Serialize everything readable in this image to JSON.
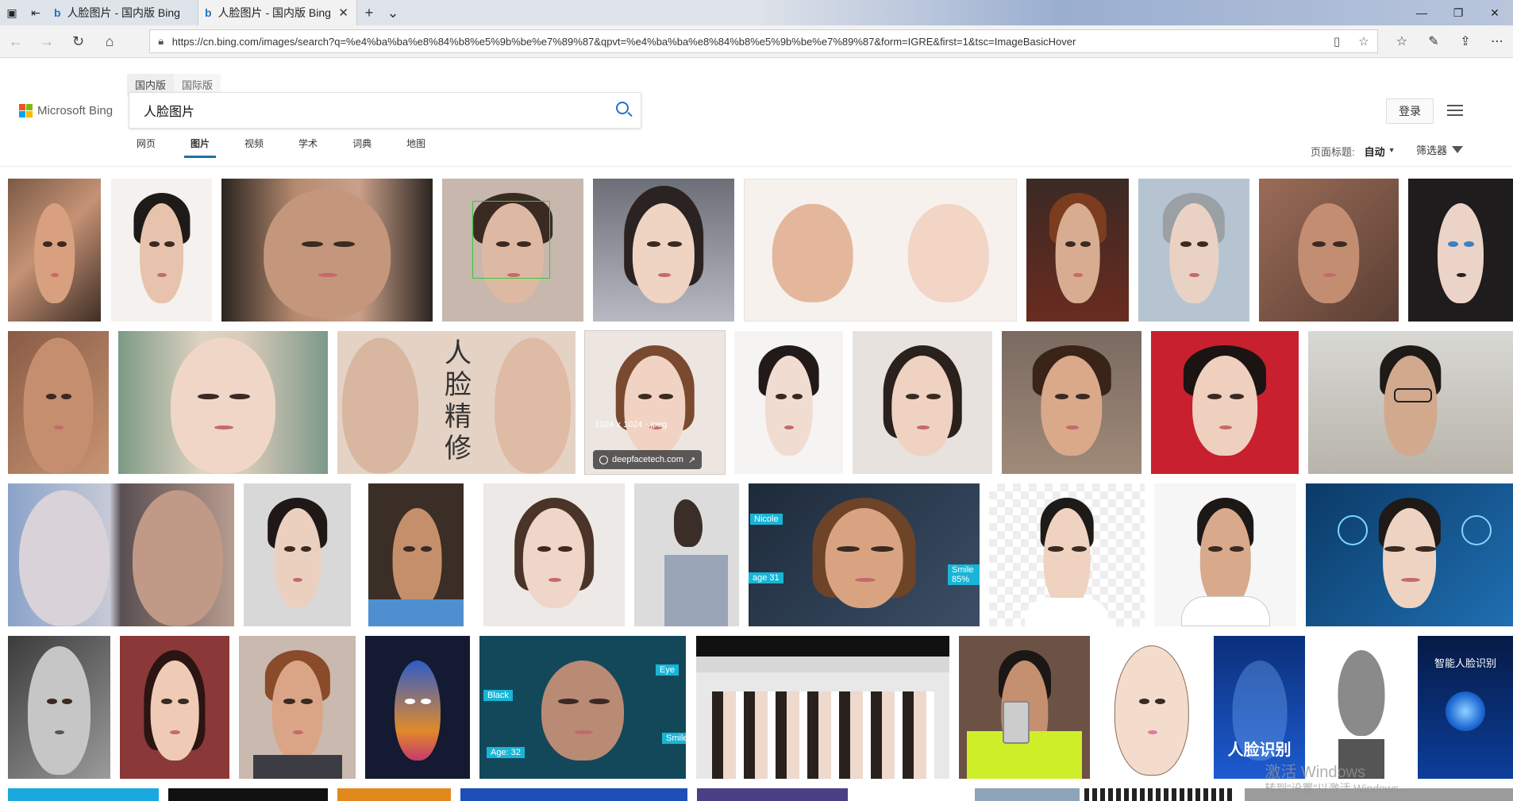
{
  "browser": {
    "tabs": [
      {
        "label": "人脸图片 - 国内版 Bing",
        "active": false
      },
      {
        "label": "人脸图片 - 国内版 Bing",
        "active": true
      }
    ],
    "url": "https://cn.bing.com/images/search?q=%e4%ba%ba%e8%84%b8%e5%9b%be%e7%89%87&qpvt=%e4%ba%ba%e8%84%b8%e5%9b%be%e7%89%87&form=IGRE&first=1&tsc=ImageBasicHover"
  },
  "bing": {
    "brand": "Microsoft Bing",
    "region_tabs": [
      "国内版",
      "国际版"
    ],
    "search_query": "人脸图片",
    "login": "登录",
    "vertical_tabs": [
      "网页",
      "图片",
      "视频",
      "学术",
      "词典",
      "地图"
    ],
    "page_title_label": "页面标题:",
    "page_title_value": "自动",
    "filter_label": "筛选器"
  },
  "hover_card": {
    "dimensions": "1024 x 1024 · jpeg",
    "source": "deepfacetech.com"
  },
  "tile_text": {
    "jingxiu": [
      "人",
      "脸",
      "精",
      "修"
    ],
    "tag_nicole": "Nicole",
    "tag_age31": "age 31",
    "tag_smile": "Smile 85%",
    "tag_black": "Black",
    "tag_eye": "Eye",
    "tag_age32": "Age: 32",
    "tag_smile2": "Smile",
    "poster_title": "人脸识别",
    "poster2_title": "智能人脸识别"
  },
  "watermark": {
    "line1": "激活 Windows",
    "line2": "转到\"设置\"以激活 Windows。"
  },
  "colors": {
    "accent": "#1a73a6",
    "search_icon": "#1a73c9",
    "ms_red": "#f25022",
    "ms_green": "#7fba00",
    "ms_blue": "#00a4ef",
    "ms_yellow": "#ffb900"
  }
}
